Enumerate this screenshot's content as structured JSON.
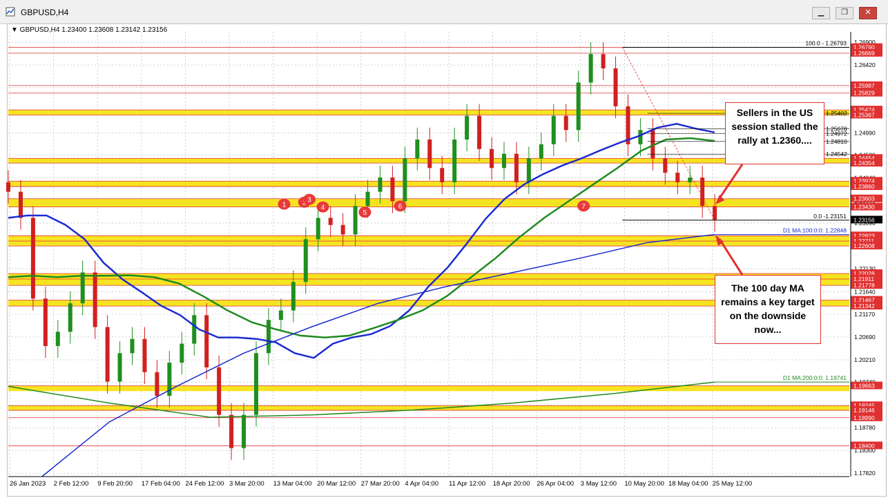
{
  "window": {
    "title": "GBPUSD,H4",
    "buttons": {
      "minimize": "▁",
      "restore": "❐",
      "close": "✕"
    }
  },
  "symbol_info": "▼ GBPUSD,H4  1.23400 1.23608 1.23142 1.23156",
  "callouts": {
    "top": "Sellers in the US session stalled the rally at 1.2360....",
    "bottom": "The 100 day MA remains a key target on the downside now..."
  },
  "colors": {
    "bull": "#1f8f1f",
    "bear": "#d12020",
    "ma_blue": "#1c2bd0",
    "ma_green": "#1f8a1f",
    "band_yellow": "#f5e10a",
    "level_red": "#e03030",
    "price_tag": "#000000"
  },
  "chart_data": {
    "type": "candlestick",
    "symbol": "GBPUSD",
    "timeframe": "H4",
    "ohlc_current": {
      "open": 1.234,
      "high": 1.23608,
      "low": 1.23142,
      "close": 1.23156
    },
    "x_tick_labels": [
      "26 Jan 2023",
      "2 Feb 12:00",
      "9 Feb 20:00",
      "17 Feb 04:00",
      "24 Feb 12:00",
      "3 Mar 20:00",
      "13 Mar 04:00",
      "20 Mar 12:00",
      "27 Mar 20:00",
      "4 Apr 04:00",
      "11 Apr 12:00",
      "18 Apr 20:00",
      "26 Apr 04:00",
      "3 May 12:00",
      "10 May 20:00",
      "18 May 04:00",
      "25 May 12:00"
    ],
    "y_tick_labels": [
      "1.26900",
      "1.26420",
      "1.25950",
      "1.25470",
      "1.24990",
      "1.24520",
      "1.24040",
      "1.23560",
      "1.23090",
      "1.22610",
      "1.22130",
      "1.21640",
      "1.21170",
      "1.20690",
      "1.20210",
      "1.19740",
      "1.19260",
      "1.18780",
      "1.18300",
      "1.17820"
    ],
    "ylim": [
      1.1775,
      1.2712
    ],
    "price_levels": [
      {
        "label": "1.26790",
        "value": 1.2679
      },
      {
        "label": "1.26669",
        "value": 1.26669
      },
      {
        "label": "1.25987",
        "value": 1.25987
      },
      {
        "label": "1.25829",
        "value": 1.25829
      },
      {
        "label": "1.25474",
        "value": 1.25474
      },
      {
        "label": "1.25367",
        "value": 1.25367
      },
      {
        "label": "1.24454",
        "value": 1.24454
      },
      {
        "label": "1.24354",
        "value": 1.24354
      },
      {
        "label": "1.23974",
        "value": 1.23974
      },
      {
        "label": "1.23860",
        "value": 1.2386
      },
      {
        "label": "1.23603",
        "value": 1.23603
      },
      {
        "label": "1.23430",
        "value": 1.2343
      },
      {
        "label": "1.22823",
        "value": 1.22823
      },
      {
        "label": "1.22711",
        "value": 1.22711
      },
      {
        "label": "1.22608",
        "value": 1.22608
      },
      {
        "label": "1.22028",
        "value": 1.22028
      },
      {
        "label": "1.21911",
        "value": 1.21911
      },
      {
        "label": "1.21778",
        "value": 1.21778
      },
      {
        "label": "1.21467",
        "value": 1.21467
      },
      {
        "label": "1.21342",
        "value": 1.21342
      },
      {
        "label": "1.19663",
        "value": 1.19663
      },
      {
        "label": "1.19245",
        "value": 1.19245
      },
      {
        "label": "1.19146",
        "value": 1.19146
      },
      {
        "label": "1.18990",
        "value": 1.1899
      },
      {
        "label": "1.18400",
        "value": 1.184
      }
    ],
    "current_price_label": "1.23156",
    "yellow_bands": [
      [
        1.25474,
        1.25367
      ],
      [
        1.24454,
        1.24354
      ],
      [
        1.23974,
        1.2386
      ],
      [
        1.23603,
        1.2343
      ],
      [
        1.22823,
        1.22608
      ],
      [
        1.22028,
        1.21778
      ],
      [
        1.21467,
        1.21342
      ],
      [
        1.19663,
        1.1955
      ],
      [
        1.19245,
        1.19146
      ]
    ],
    "fib_levels": [
      {
        "label": "100.0 - 1.26793",
        "value": 1.26793
      },
      {
        "label": "0.0 -1.23151",
        "value": 1.23151
      }
    ],
    "ma_labels": [
      {
        "label": "D1 MA:100:0:0: 1.22848",
        "value": 1.22848
      },
      {
        "label": "D1 MA:200:0:0: 1.19741",
        "value": 1.19741
      }
    ],
    "right_annotations": [
      {
        "label": "1.25402",
        "value": 1.25402
      },
      {
        "label": "1.25078",
        "value": 1.25078
      },
      {
        "label": "1.24972",
        "value": 1.24972
      },
      {
        "label": "1.24810",
        "value": 1.2481
      },
      {
        "label": "1.24542",
        "value": 1.24542
      }
    ],
    "circle_markers": [
      {
        "label": "1",
        "x_index": 0.328,
        "value": 1.2349
      },
      {
        "label": "2",
        "x_index": 0.352,
        "value": 1.2353
      },
      {
        "label": "3",
        "x_index": 0.358,
        "value": 1.2359
      },
      {
        "label": "4",
        "x_index": 0.374,
        "value": 1.2343
      },
      {
        "label": "5",
        "x_index": 0.424,
        "value": 1.2332
      },
      {
        "label": "6",
        "x_index": 0.466,
        "value": 1.2345
      },
      {
        "label": "7",
        "x_index": 0.684,
        "value": 1.2345
      }
    ],
    "ma_blue_100": [
      1.232,
      1.2325,
      1.2325,
      1.2305,
      1.2275,
      1.2225,
      1.219,
      1.2163,
      1.2135,
      1.2115,
      1.2085,
      1.2068,
      1.2068,
      1.2065,
      1.2058,
      1.2035,
      1.2025,
      1.2055,
      1.2068,
      1.2075,
      1.2092,
      1.2125,
      1.2175,
      1.2215,
      1.2265,
      1.2318,
      1.236,
      1.239,
      1.2412,
      1.243,
      1.2445,
      1.2462,
      1.2478,
      1.2492,
      1.251,
      1.2518,
      1.2508,
      1.25
    ],
    "ma_green_200": [
      1.2195,
      1.2198,
      1.2195,
      1.2198,
      1.2198,
      1.2199,
      1.2195,
      1.2182,
      1.2155,
      1.2125,
      1.21,
      1.2085,
      1.2072,
      1.2068,
      1.2072,
      1.2088,
      1.2105,
      1.2125,
      1.2155,
      1.2195,
      1.2235,
      1.228,
      1.232,
      1.2355,
      1.239,
      1.2425,
      1.2462,
      1.2485,
      1.2488,
      1.2482
    ],
    "ma_blue_daily_100": [
      1.1775,
      1.189,
      1.1965,
      1.2035,
      1.209,
      1.214,
      1.2175,
      1.2205,
      1.2235,
      1.2268,
      1.2285
    ],
    "ma_green_daily_200": [
      1.1965,
      1.193,
      1.19,
      1.1905,
      1.1915,
      1.193,
      1.195,
      1.1974
    ],
    "close_series": [
      1.2375,
      1.232,
      1.215,
      1.205,
      1.208,
      1.214,
      1.2205,
      1.209,
      1.1975,
      1.2035,
      1.2065,
      1.1995,
      1.1945,
      1.2015,
      1.2055,
      1.2115,
      1.2005,
      1.1905,
      1.1835,
      1.1905,
      1.2035,
      1.2105,
      1.2125,
      1.2185,
      1.2275,
      1.232,
      1.2305,
      1.2285,
      1.2345,
      1.2375,
      1.2405,
      1.2355,
      1.2445,
      1.2485,
      1.2425,
      1.2395,
      1.2485,
      1.2535,
      1.2465,
      1.2425,
      1.2455,
      1.2395,
      1.2445,
      1.2475,
      1.2535,
      1.2505,
      1.2605,
      1.2665,
      1.2635,
      1.2555,
      1.2475,
      1.2505,
      1.2445,
      1.2415,
      1.2395,
      1.2405,
      1.2345,
      1.2316
    ]
  }
}
